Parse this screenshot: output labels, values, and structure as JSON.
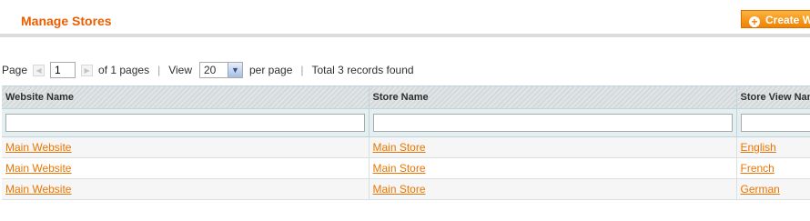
{
  "page": {
    "title": "Manage Stores",
    "create_button": "Create Website"
  },
  "pager": {
    "page_label": "Page",
    "current_page": "1",
    "of_pages": "of 1 pages",
    "view_label": "View",
    "per_page_value": "20",
    "per_page_label": "per page",
    "records": "Total 3 records found"
  },
  "grid": {
    "columns": [
      "Website Name",
      "Store Name",
      "Store View Name"
    ],
    "rows": [
      {
        "website": "Main Website",
        "store": "Main Store",
        "view": "English"
      },
      {
        "website": "Main Website",
        "store": "Main Store",
        "view": "French"
      },
      {
        "website": "Main Website",
        "store": "Main Store",
        "view": "German"
      }
    ]
  },
  "colors": {
    "accent": "#eb5e00",
    "link": "#ea7601",
    "button": "#f18200"
  },
  "icons": {
    "create": "plus-circle-icon",
    "prev": "arrow-left-icon",
    "next": "arrow-right-icon",
    "dropdown": "chevron-down-icon"
  }
}
